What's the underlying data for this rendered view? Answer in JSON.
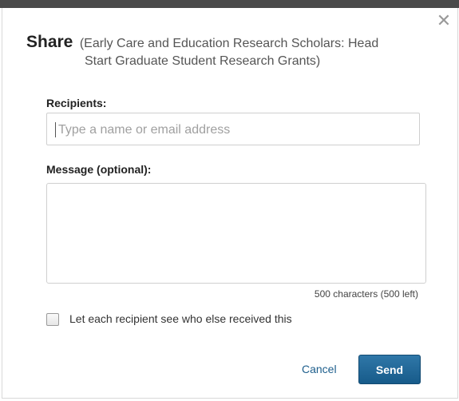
{
  "dialog": {
    "title": "Share",
    "subtitle_line1": "(Early Care and Education Research Scholars: Head",
    "subtitle_line2": "Start Graduate Student Research Grants)",
    "close_icon": "close-icon"
  },
  "recipients": {
    "label": "Recipients:",
    "placeholder": "Type a name or email address",
    "value": ""
  },
  "message": {
    "label": "Message (optional):",
    "value": "",
    "counter": "500 characters (500 left)"
  },
  "options": {
    "show_recipients_label": "Let each recipient see who else received this",
    "show_recipients_checked": false
  },
  "actions": {
    "cancel_label": "Cancel",
    "send_label": "Send"
  },
  "colors": {
    "send_button": "#1f6a9a",
    "link": "#1d5e8c",
    "top_bar": "#4a4a4a"
  }
}
